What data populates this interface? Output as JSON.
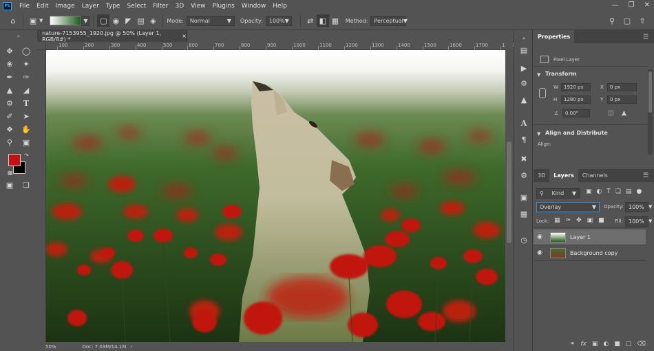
{
  "menu": [
    "File",
    "Edit",
    "Image",
    "Layer",
    "Type",
    "Select",
    "Filter",
    "3D",
    "View",
    "Plugins",
    "Window",
    "Help"
  ],
  "app_logo": "Ps",
  "options": {
    "mode_label": "Mode:",
    "mode_value": "Normal",
    "opacity_label": "Opacity:",
    "opacity_value": "100%",
    "method_label": "Method:",
    "method_value": "Perceptual"
  },
  "document": {
    "tab_title": "nature-7153955_1920.jpg @ 50% (Layer 1, RGB/8#) *",
    "zoom": "50%",
    "doc_size": "Doc: 7.03M/14.1M"
  },
  "ruler": [
    "100",
    "200",
    "300",
    "400",
    "500",
    "600",
    "700",
    "800",
    "900",
    "1000",
    "1100",
    "1200",
    "1300",
    "1400",
    "1500",
    "1600",
    "1700",
    "1800"
  ],
  "properties": {
    "tab": "Properties",
    "kind": "Pixel Layer",
    "transform_title": "Transform",
    "w_label": "W",
    "w_value": "1920 px",
    "h_label": "H",
    "h_value": "1280 px",
    "x_label": "X",
    "x_value": "0 px",
    "y_label": "Y",
    "y_value": "0 px",
    "angle_value": "0.00°",
    "align_title": "Align and Distribute",
    "align_label": "Align:"
  },
  "layers_panel": {
    "tabs": [
      "3D",
      "Layers",
      "Channels"
    ],
    "active_tab": "Layers",
    "filter_kind": "Kind",
    "blend_mode": "Overlay",
    "opacity_label": "Opacity:",
    "opacity_value": "100%",
    "lock_label": "Lock:",
    "fill_label": "Fill:",
    "fill_value": "100%",
    "layers": [
      {
        "name": "Layer 1",
        "selected": true
      },
      {
        "name": "Background copy",
        "selected": false
      }
    ]
  },
  "colors": {
    "foreground": "#c41212",
    "background": "#000000"
  }
}
